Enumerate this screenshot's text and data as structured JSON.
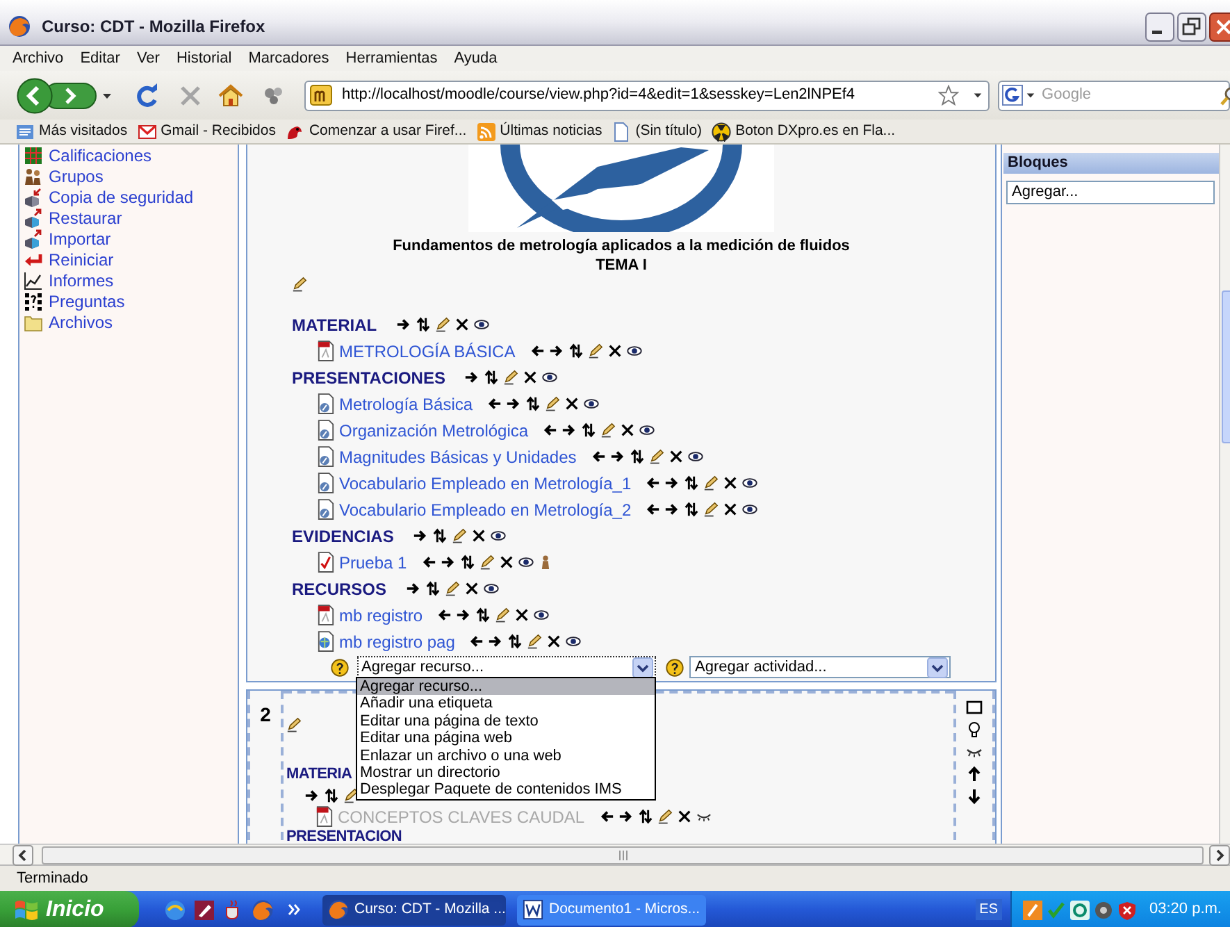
{
  "window": {
    "title": "Curso: CDT - Mozilla Firefox"
  },
  "menu": [
    "Archivo",
    "Editar",
    "Ver",
    "Historial",
    "Marcadores",
    "Herramientas",
    "Ayuda"
  ],
  "toolbar": {
    "url": "http://localhost/moodle/course/view.php?id=4&edit=1&sesskey=Len2lNPEf4",
    "search_placeholder": "Google"
  },
  "bookmarks": [
    "Más visitados",
    "Gmail - Recibidos",
    "Comenzar a usar Firef...",
    "Últimas noticias",
    "(Sin título)",
    "Boton DXpro.es en Fla..."
  ],
  "sidebar": {
    "items": [
      "Calificaciones",
      "Grupos",
      "Copia de seguridad",
      "Restaurar",
      "Importar",
      "Reiniciar",
      "Informes",
      "Preguntas",
      "Archivos"
    ]
  },
  "course": {
    "title": "Fundamentos de metrología aplicados a la medición de fluidos",
    "subtitle": "TEMA I",
    "sections": [
      {
        "rows": [
          {
            "kind": "heading",
            "text": "MATERIAL"
          },
          {
            "kind": "pdf",
            "text": "METROLOGÍA BÁSICA",
            "hidden": false
          },
          {
            "kind": "heading",
            "text": "PRESENTACIONES"
          },
          {
            "kind": "presentation",
            "text": "Metrología Básica",
            "hidden": false
          },
          {
            "kind": "presentation",
            "text": "Organización Metrológica",
            "hidden": false
          },
          {
            "kind": "presentation",
            "text": "Magnitudes Básicas y Unidades",
            "hidden": false
          },
          {
            "kind": "presentation",
            "text": "Vocabulario Empleado en Metrología_1",
            "hidden": false
          },
          {
            "kind": "presentation",
            "text": "Vocabulario Empleado en Metrología_2",
            "hidden": false
          },
          {
            "kind": "heading",
            "text": "EVIDENCIAS"
          },
          {
            "kind": "quiz",
            "text": "Prueba 1",
            "hidden": false
          },
          {
            "kind": "heading",
            "text": "RECURSOS"
          },
          {
            "kind": "pdf",
            "text": "mb registro",
            "hidden": false
          },
          {
            "kind": "web",
            "text": "mb registro pag",
            "hidden": false
          }
        ],
        "add_resource": {
          "value": "Agregar recurso...",
          "expanded": true,
          "options": [
            {
              "label": "Agregar recurso...",
              "selected": true
            },
            {
              "label": "Añadir una etiqueta",
              "selected": false
            },
            {
              "label": "Editar una página de texto",
              "selected": false
            },
            {
              "label": "Editar una página web",
              "selected": false
            },
            {
              "label": "Enlazar un archivo o una web",
              "selected": false
            },
            {
              "label": "Mostrar un directorio",
              "selected": false
            },
            {
              "label": "Desplegar Paquete de contenidos IMS",
              "selected": false
            }
          ]
        },
        "add_activity": {
          "value": "Agregar actividad..."
        }
      },
      {
        "number": "2",
        "rows": [
          {
            "kind": "heading",
            "text": "MATERIA"
          },
          {
            "kind": "actions"
          },
          {
            "kind": "pdf",
            "text": "CONCEPTOS CLAVES CAUDAL",
            "hidden": true
          },
          {
            "kind": "heading",
            "text": "PRESENTACION"
          }
        ]
      }
    ]
  },
  "blocks": {
    "title": "Bloques",
    "add_placeholder": "Agregar..."
  },
  "status_bar": "Terminado",
  "taskbar": {
    "start": "Inicio",
    "tasks": [
      {
        "label": "Curso: CDT - Mozilla ...",
        "selected": true
      },
      {
        "label": "Documento1 - Micros...",
        "selected": false
      }
    ],
    "language": "ES",
    "clock": "03:20 p.m."
  }
}
